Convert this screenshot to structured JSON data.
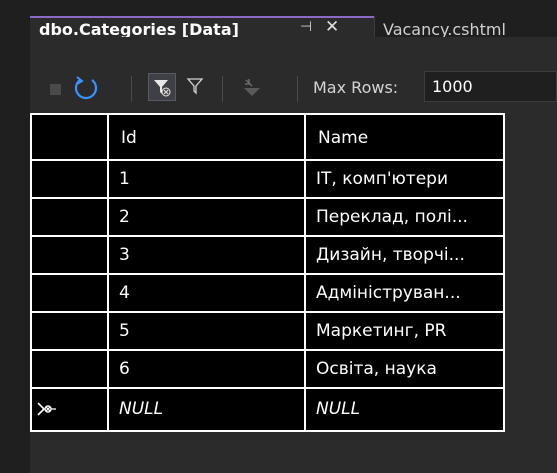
{
  "tabs": {
    "active_title": "dbo.Categories [Data]",
    "pin_glyph": "⊣",
    "close_glyph": "✕",
    "inactive_title": "Vacancy.cshtml"
  },
  "toolbar": {
    "max_rows_label": "Max Rows:",
    "max_rows_value": "1000",
    "icons": [
      "stop-icon",
      "refresh-icon",
      "filter-applied-icon",
      "filter-icon",
      "execute-sql-icon"
    ]
  },
  "grid": {
    "columns": [
      "Id",
      "Name"
    ],
    "rows": [
      [
        "1",
        "IT, комп'ютери"
      ],
      [
        "2",
        "Переклад, полі..."
      ],
      [
        "3",
        "Дизайн, творчі..."
      ],
      [
        "4",
        "Адмініструван..."
      ],
      [
        "5",
        "Маркетинг, PR"
      ],
      [
        "6",
        "Освіта, наука"
      ]
    ],
    "new_row": [
      "NULL",
      "NULL"
    ]
  },
  "colors": {
    "background": "#1f1f1f",
    "panel": "#2b2b2b",
    "accent": "#8a69c9",
    "grid_cell": "#000000",
    "grid_line": "#ffffff"
  }
}
